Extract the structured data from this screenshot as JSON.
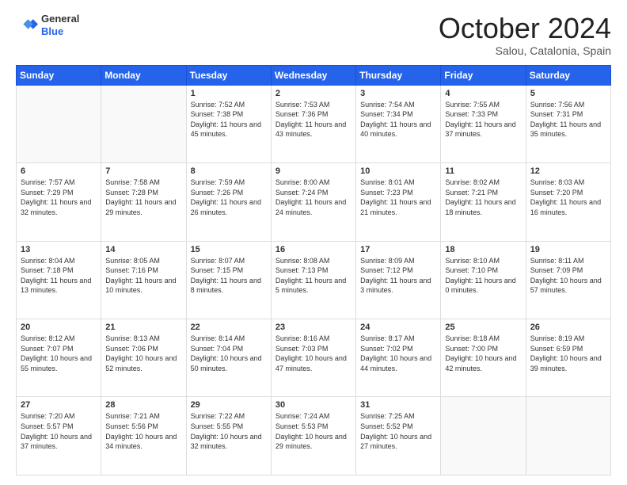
{
  "header": {
    "logo_general": "General",
    "logo_blue": "Blue",
    "month_title": "October 2024",
    "location": "Salou, Catalonia, Spain"
  },
  "days_of_week": [
    "Sunday",
    "Monday",
    "Tuesday",
    "Wednesday",
    "Thursday",
    "Friday",
    "Saturday"
  ],
  "weeks": [
    [
      {
        "day": "",
        "info": ""
      },
      {
        "day": "",
        "info": ""
      },
      {
        "day": "1",
        "info": "Sunrise: 7:52 AM\nSunset: 7:38 PM\nDaylight: 11 hours and 45 minutes."
      },
      {
        "day": "2",
        "info": "Sunrise: 7:53 AM\nSunset: 7:36 PM\nDaylight: 11 hours and 43 minutes."
      },
      {
        "day": "3",
        "info": "Sunrise: 7:54 AM\nSunset: 7:34 PM\nDaylight: 11 hours and 40 minutes."
      },
      {
        "day": "4",
        "info": "Sunrise: 7:55 AM\nSunset: 7:33 PM\nDaylight: 11 hours and 37 minutes."
      },
      {
        "day": "5",
        "info": "Sunrise: 7:56 AM\nSunset: 7:31 PM\nDaylight: 11 hours and 35 minutes."
      }
    ],
    [
      {
        "day": "6",
        "info": "Sunrise: 7:57 AM\nSunset: 7:29 PM\nDaylight: 11 hours and 32 minutes."
      },
      {
        "day": "7",
        "info": "Sunrise: 7:58 AM\nSunset: 7:28 PM\nDaylight: 11 hours and 29 minutes."
      },
      {
        "day": "8",
        "info": "Sunrise: 7:59 AM\nSunset: 7:26 PM\nDaylight: 11 hours and 26 minutes."
      },
      {
        "day": "9",
        "info": "Sunrise: 8:00 AM\nSunset: 7:24 PM\nDaylight: 11 hours and 24 minutes."
      },
      {
        "day": "10",
        "info": "Sunrise: 8:01 AM\nSunset: 7:23 PM\nDaylight: 11 hours and 21 minutes."
      },
      {
        "day": "11",
        "info": "Sunrise: 8:02 AM\nSunset: 7:21 PM\nDaylight: 11 hours and 18 minutes."
      },
      {
        "day": "12",
        "info": "Sunrise: 8:03 AM\nSunset: 7:20 PM\nDaylight: 11 hours and 16 minutes."
      }
    ],
    [
      {
        "day": "13",
        "info": "Sunrise: 8:04 AM\nSunset: 7:18 PM\nDaylight: 11 hours and 13 minutes."
      },
      {
        "day": "14",
        "info": "Sunrise: 8:05 AM\nSunset: 7:16 PM\nDaylight: 11 hours and 10 minutes."
      },
      {
        "day": "15",
        "info": "Sunrise: 8:07 AM\nSunset: 7:15 PM\nDaylight: 11 hours and 8 minutes."
      },
      {
        "day": "16",
        "info": "Sunrise: 8:08 AM\nSunset: 7:13 PM\nDaylight: 11 hours and 5 minutes."
      },
      {
        "day": "17",
        "info": "Sunrise: 8:09 AM\nSunset: 7:12 PM\nDaylight: 11 hours and 3 minutes."
      },
      {
        "day": "18",
        "info": "Sunrise: 8:10 AM\nSunset: 7:10 PM\nDaylight: 11 hours and 0 minutes."
      },
      {
        "day": "19",
        "info": "Sunrise: 8:11 AM\nSunset: 7:09 PM\nDaylight: 10 hours and 57 minutes."
      }
    ],
    [
      {
        "day": "20",
        "info": "Sunrise: 8:12 AM\nSunset: 7:07 PM\nDaylight: 10 hours and 55 minutes."
      },
      {
        "day": "21",
        "info": "Sunrise: 8:13 AM\nSunset: 7:06 PM\nDaylight: 10 hours and 52 minutes."
      },
      {
        "day": "22",
        "info": "Sunrise: 8:14 AM\nSunset: 7:04 PM\nDaylight: 10 hours and 50 minutes."
      },
      {
        "day": "23",
        "info": "Sunrise: 8:16 AM\nSunset: 7:03 PM\nDaylight: 10 hours and 47 minutes."
      },
      {
        "day": "24",
        "info": "Sunrise: 8:17 AM\nSunset: 7:02 PM\nDaylight: 10 hours and 44 minutes."
      },
      {
        "day": "25",
        "info": "Sunrise: 8:18 AM\nSunset: 7:00 PM\nDaylight: 10 hours and 42 minutes."
      },
      {
        "day": "26",
        "info": "Sunrise: 8:19 AM\nSunset: 6:59 PM\nDaylight: 10 hours and 39 minutes."
      }
    ],
    [
      {
        "day": "27",
        "info": "Sunrise: 7:20 AM\nSunset: 5:57 PM\nDaylight: 10 hours and 37 minutes."
      },
      {
        "day": "28",
        "info": "Sunrise: 7:21 AM\nSunset: 5:56 PM\nDaylight: 10 hours and 34 minutes."
      },
      {
        "day": "29",
        "info": "Sunrise: 7:22 AM\nSunset: 5:55 PM\nDaylight: 10 hours and 32 minutes."
      },
      {
        "day": "30",
        "info": "Sunrise: 7:24 AM\nSunset: 5:53 PM\nDaylight: 10 hours and 29 minutes."
      },
      {
        "day": "31",
        "info": "Sunrise: 7:25 AM\nSunset: 5:52 PM\nDaylight: 10 hours and 27 minutes."
      },
      {
        "day": "",
        "info": ""
      },
      {
        "day": "",
        "info": ""
      }
    ]
  ]
}
